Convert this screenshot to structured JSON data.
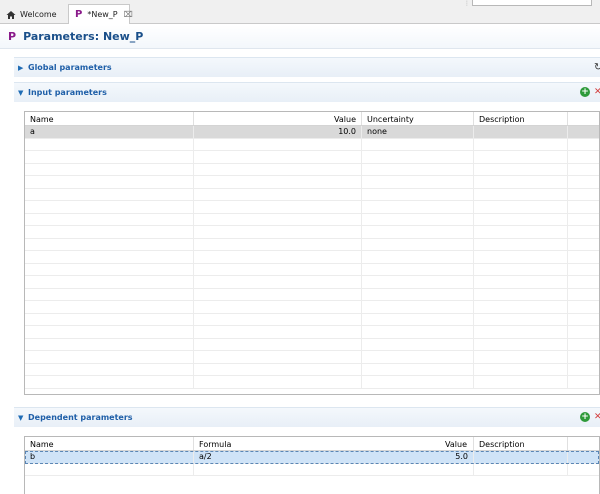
{
  "tabs": [
    {
      "label": "Welcome",
      "icon": "home-icon"
    },
    {
      "label": "*New_P",
      "icon": "p-icon",
      "close": "⌧"
    }
  ],
  "editor": {
    "icon_letter": "P",
    "title": "Parameters: New_P"
  },
  "sections": {
    "global": {
      "label": "Global parameters",
      "expanded": false
    },
    "input": {
      "label": "Input parameters",
      "expanded": true,
      "columns": [
        "Name",
        "Value",
        "Uncertainty",
        "Description"
      ],
      "rows": [
        {
          "name": "a",
          "value": "10.0",
          "uncertainty": "none",
          "description": ""
        }
      ]
    },
    "dependent": {
      "label": "Dependent parameters",
      "expanded": true,
      "columns": [
        "Name",
        "Formula",
        "Value",
        "Description"
      ],
      "rows": [
        {
          "name": "b",
          "formula": "a/2",
          "value": "5.0",
          "description": ""
        }
      ]
    }
  },
  "icons": {
    "expanded": "▼",
    "collapsed": "▶",
    "add": "+",
    "remove": "✕"
  },
  "colors": {
    "accent": "#1f5fa8",
    "add": "#2e9a3a",
    "remove": "#d23a3a",
    "selection": "#cfe3f7"
  }
}
